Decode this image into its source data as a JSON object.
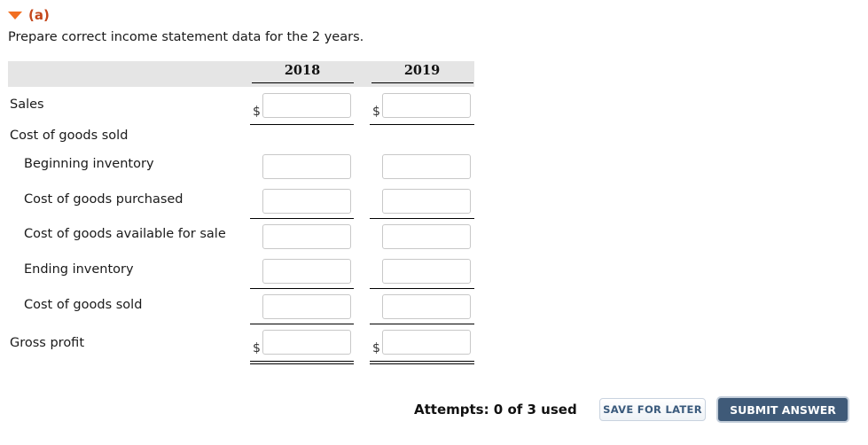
{
  "part": {
    "label": "(a)",
    "icon": "triangle-down-icon",
    "accent_color": "#f26f21",
    "instruction": "Prepare correct income statement data for the 2 years."
  },
  "table": {
    "columns": [
      "2018",
      "2019"
    ],
    "rows": [
      {
        "label": "Sales",
        "currency_symbol": "$",
        "values": [
          "",
          ""
        ]
      },
      {
        "label": "Cost of goods sold",
        "values": null
      },
      {
        "label": "Beginning inventory",
        "values": [
          "",
          ""
        ]
      },
      {
        "label": "Cost of goods purchased",
        "values": [
          "",
          ""
        ]
      },
      {
        "label": "Cost of goods available for sale",
        "values": [
          "",
          ""
        ]
      },
      {
        "label": "Ending inventory",
        "values": [
          "",
          ""
        ]
      },
      {
        "label": "Cost of goods sold",
        "values": [
          "",
          ""
        ]
      },
      {
        "label": "Gross profit",
        "currency_symbol": "$",
        "values": [
          "",
          ""
        ]
      }
    ]
  },
  "footer": {
    "attempts": "Attempts: 0 of 3 used",
    "save_label": "SAVE FOR LATER",
    "submit_label": "SUBMIT ANSWER"
  }
}
